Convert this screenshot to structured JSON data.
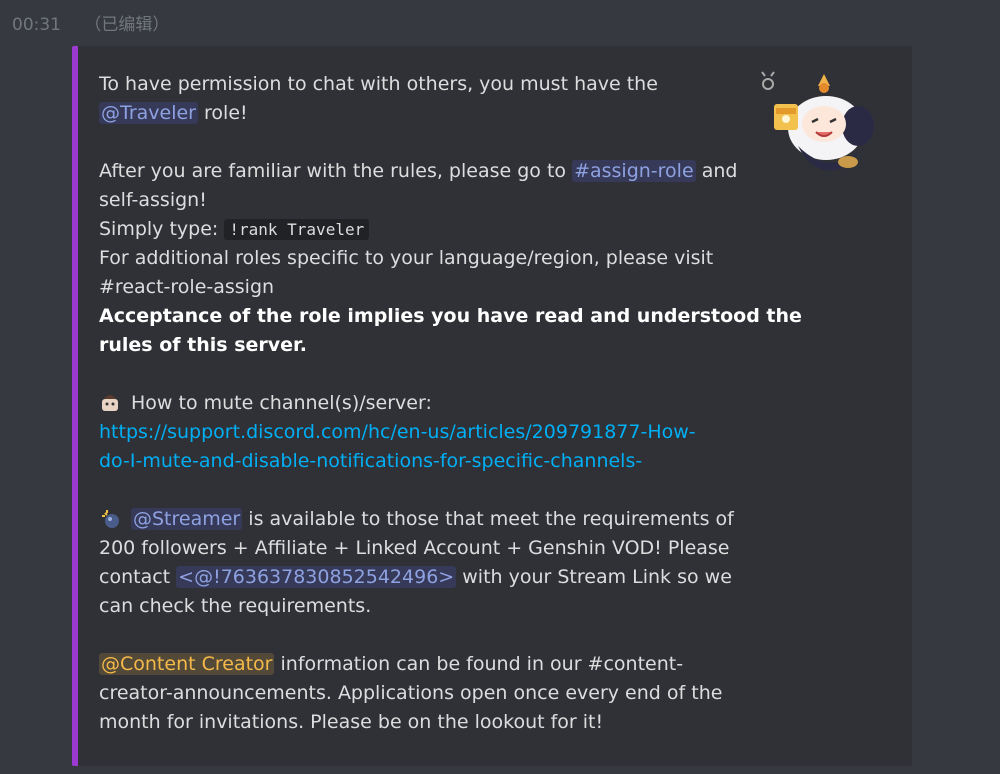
{
  "header": {
    "time": "00:31",
    "edited": "（已编辑）"
  },
  "embed": {
    "accent_color": "#9b3ad0",
    "thumbnail_icon": "chibi-character-sticker",
    "p1_text": "To have permission to chat with others, you must have the",
    "traveler_mention": "@Traveler",
    "role_suffix": " role!",
    "p2_before": "After you are familiar with the rules, please go to ",
    "assign_role_channel": "#assign-role",
    "p2_after": " and",
    "p2_line2": "self-assign!",
    "simply_type": "Simply type: ",
    "rank_command": "!rank Traveler",
    "additional_line1": "For additional roles specific to your language/region, please visit",
    "additional_line2": "#react-role-assign",
    "acceptance_line1": "Acceptance of the role implies you have read and understood the",
    "acceptance_line2": "rules of this server.",
    "mute_icon": "mute-emoji-icon",
    "mute_label": "How to mute channel(s)/server:",
    "mute_link_line1": "https://support.discord.com/hc/en-us/articles/209791877-How-",
    "mute_link_line2": "do-I-mute-and-disable-notifications-for-specific-channels-",
    "streamer_icon": "sparkle-bomb-emoji-icon",
    "streamer_mention": "@Streamer",
    "streamer_text1": " is available to those that meet the requirements of",
    "streamer_text2": "200 followers + Affiliate + Linked Account + Genshin VOD! Please",
    "contact_text": "contact ",
    "user_mention": "<@!763637830852542496>",
    "contact_after": " with your Stream Link so we",
    "contact_line2": "can check the requirements.",
    "content_creator_mention": "@Content Creator",
    "cc_text1": " information can be found in our #content-",
    "cc_text2": "creator-announcements. Applications open once every end of the",
    "cc_text3": "month for invitations. Please be on the lookout for it!"
  }
}
